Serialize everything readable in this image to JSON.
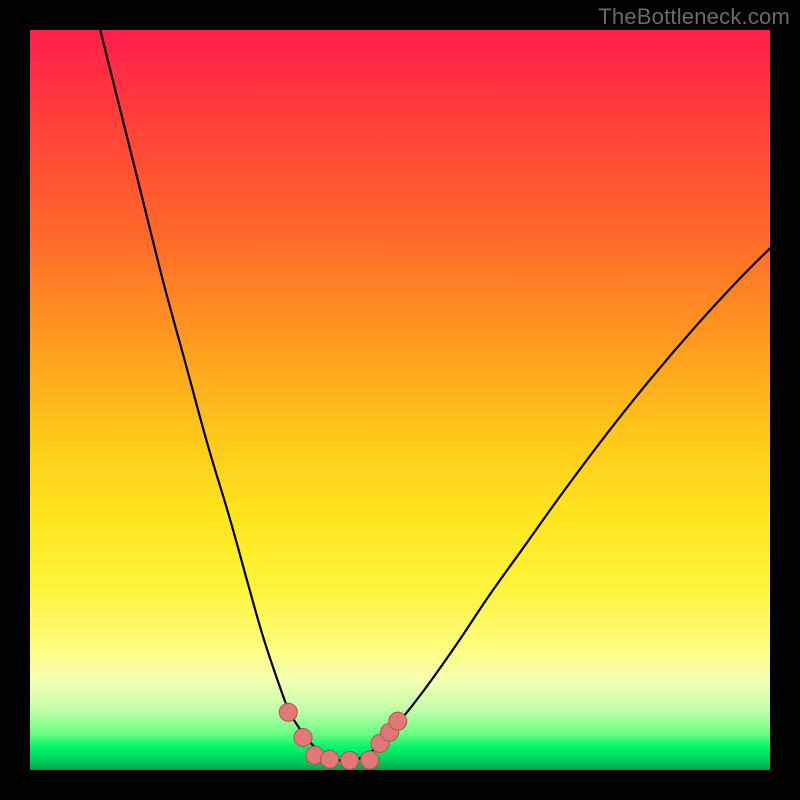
{
  "watermark": {
    "text": "TheBottleneck.com"
  },
  "colors": {
    "curve": "#000000",
    "marker_fill": "#e27878",
    "marker_stroke": "#b54f4f",
    "gradient_top": "#ff1f4b",
    "gradient_bottom": "#009f4a"
  },
  "chart_data": {
    "type": "line",
    "title": "",
    "xlabel": "",
    "ylabel": "",
    "xlim": [
      0,
      100
    ],
    "ylim": [
      0,
      100
    ],
    "grid": false,
    "legend": false,
    "note": "Two black curves descending from the top edge and meeting/flattening near the bottom. A few salmon markers sit on the curves near the trough. Values are estimated from pixel positions; axes have no tick labels.",
    "series": [
      {
        "name": "left-curve",
        "x": [
          9.5,
          12,
          15,
          18,
          21,
          24,
          27,
          29.5,
          31.5,
          33.5,
          35,
          36.5,
          37.8,
          39,
          40,
          41,
          42,
          43
        ],
        "y": [
          100,
          90,
          78,
          66,
          55,
          44,
          34,
          25,
          18,
          12,
          8,
          5.5,
          3.8,
          2.6,
          1.9,
          1.5,
          1.3,
          1.25
        ]
      },
      {
        "name": "right-curve",
        "x": [
          43,
          44,
          45.5,
          47,
          49,
          51.5,
          54.5,
          58,
          62,
          67,
          72,
          78,
          84,
          90,
          96,
          100
        ],
        "y": [
          1.25,
          1.4,
          2.0,
          3.3,
          5.5,
          8.5,
          12.5,
          17.5,
          23.5,
          30.5,
          37.5,
          45.5,
          53,
          60,
          66.5,
          70.5
        ]
      }
    ],
    "markers": [
      {
        "x": 34.9,
        "y": 7.8
      },
      {
        "x": 36.9,
        "y": 4.4
      },
      {
        "x": 38.5,
        "y": 2.0
      },
      {
        "x": 40.5,
        "y": 1.45
      },
      {
        "x": 43.2,
        "y": 1.3
      },
      {
        "x": 45.9,
        "y": 1.35
      },
      {
        "x": 47.3,
        "y": 3.6
      },
      {
        "x": 48.6,
        "y": 5.1
      },
      {
        "x": 49.7,
        "y": 6.6
      }
    ]
  }
}
